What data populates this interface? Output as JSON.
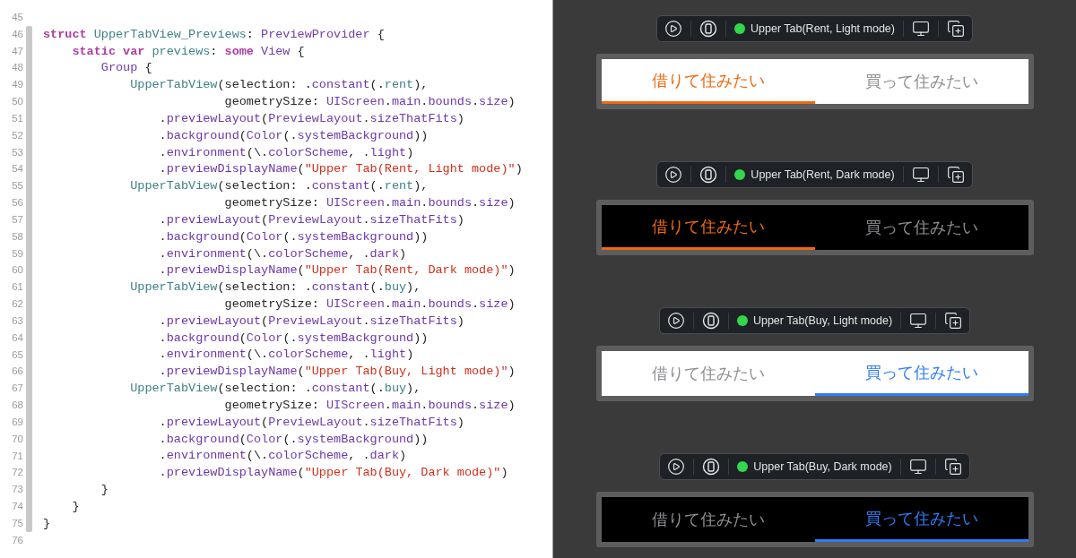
{
  "editor": {
    "lines": [
      {
        "number": "45"
      },
      {
        "number": "46",
        "tokens": [
          {
            "kind": "keyword",
            "text": "struct"
          },
          {
            "kind": "project",
            "text": " UpperTabView_Previews"
          },
          {
            "kind": "plain",
            "text": ": "
          },
          {
            "kind": "type",
            "text": "PreviewProvider"
          },
          {
            "kind": "plain",
            "text": " {"
          }
        ]
      },
      {
        "number": "47",
        "tokens": [
          {
            "kind": "keyword",
            "text": "    static var"
          },
          {
            "kind": "project",
            "text": " previews"
          },
          {
            "kind": "plain",
            "text": ": "
          },
          {
            "kind": "keyword",
            "text": "some"
          },
          {
            "kind": "type",
            "text": " View"
          },
          {
            "kind": "plain",
            "text": " {"
          }
        ]
      },
      {
        "number": "48",
        "tokens": [
          {
            "kind": "type",
            "text": "        Group"
          },
          {
            "kind": "plain",
            "text": " {"
          }
        ]
      },
      {
        "number": "49",
        "tokens": [
          {
            "kind": "project",
            "text": "            UpperTabView"
          },
          {
            "kind": "plain",
            "text": "(selection: ."
          },
          {
            "kind": "member",
            "text": "constant"
          },
          {
            "kind": "plain",
            "text": "(."
          },
          {
            "kind": "project",
            "text": "rent"
          },
          {
            "kind": "plain",
            "text": "),"
          }
        ]
      },
      {
        "number": "50",
        "tokens": [
          {
            "kind": "plain",
            "text": "                         geometrySize: "
          },
          {
            "kind": "type",
            "text": "UIScreen"
          },
          {
            "kind": "plain",
            "text": "."
          },
          {
            "kind": "member",
            "text": "main"
          },
          {
            "kind": "plain",
            "text": "."
          },
          {
            "kind": "member",
            "text": "bounds"
          },
          {
            "kind": "plain",
            "text": "."
          },
          {
            "kind": "member",
            "text": "size"
          },
          {
            "kind": "plain",
            "text": ")"
          }
        ]
      },
      {
        "number": "51",
        "tokens": [
          {
            "kind": "plain",
            "text": "                ."
          },
          {
            "kind": "member",
            "text": "previewLayout"
          },
          {
            "kind": "plain",
            "text": "("
          },
          {
            "kind": "type",
            "text": "PreviewLayout"
          },
          {
            "kind": "plain",
            "text": "."
          },
          {
            "kind": "member",
            "text": "sizeThatFits"
          },
          {
            "kind": "plain",
            "text": ")"
          }
        ]
      },
      {
        "number": "52",
        "tokens": [
          {
            "kind": "plain",
            "text": "                ."
          },
          {
            "kind": "member",
            "text": "background"
          },
          {
            "kind": "plain",
            "text": "("
          },
          {
            "kind": "type",
            "text": "Color"
          },
          {
            "kind": "plain",
            "text": "(."
          },
          {
            "kind": "member",
            "text": "systemBackground"
          },
          {
            "kind": "plain",
            "text": "))"
          }
        ]
      },
      {
        "number": "53",
        "tokens": [
          {
            "kind": "plain",
            "text": "                ."
          },
          {
            "kind": "member",
            "text": "environment"
          },
          {
            "kind": "plain",
            "text": "(\\."
          },
          {
            "kind": "member",
            "text": "colorScheme"
          },
          {
            "kind": "plain",
            "text": ", ."
          },
          {
            "kind": "member",
            "text": "light"
          },
          {
            "kind": "plain",
            "text": ")"
          }
        ]
      },
      {
        "number": "54",
        "tokens": [
          {
            "kind": "plain",
            "text": "                ."
          },
          {
            "kind": "member",
            "text": "previewDisplayName"
          },
          {
            "kind": "plain",
            "text": "("
          },
          {
            "kind": "string",
            "text": "\"Upper Tab(Rent, Light mode)\""
          },
          {
            "kind": "plain",
            "text": ")"
          }
        ]
      },
      {
        "number": "55",
        "tokens": [
          {
            "kind": "project",
            "text": "            UpperTabView"
          },
          {
            "kind": "plain",
            "text": "(selection: ."
          },
          {
            "kind": "member",
            "text": "constant"
          },
          {
            "kind": "plain",
            "text": "(."
          },
          {
            "kind": "project",
            "text": "rent"
          },
          {
            "kind": "plain",
            "text": "),"
          }
        ]
      },
      {
        "number": "56",
        "tokens": [
          {
            "kind": "plain",
            "text": "                         geometrySize: "
          },
          {
            "kind": "type",
            "text": "UIScreen"
          },
          {
            "kind": "plain",
            "text": "."
          },
          {
            "kind": "member",
            "text": "main"
          },
          {
            "kind": "plain",
            "text": "."
          },
          {
            "kind": "member",
            "text": "bounds"
          },
          {
            "kind": "plain",
            "text": "."
          },
          {
            "kind": "member",
            "text": "size"
          },
          {
            "kind": "plain",
            "text": ")"
          }
        ]
      },
      {
        "number": "57",
        "tokens": [
          {
            "kind": "plain",
            "text": "                ."
          },
          {
            "kind": "member",
            "text": "previewLayout"
          },
          {
            "kind": "plain",
            "text": "("
          },
          {
            "kind": "type",
            "text": "PreviewLayout"
          },
          {
            "kind": "plain",
            "text": "."
          },
          {
            "kind": "member",
            "text": "sizeThatFits"
          },
          {
            "kind": "plain",
            "text": ")"
          }
        ]
      },
      {
        "number": "58",
        "tokens": [
          {
            "kind": "plain",
            "text": "                ."
          },
          {
            "kind": "member",
            "text": "background"
          },
          {
            "kind": "plain",
            "text": "("
          },
          {
            "kind": "type",
            "text": "Color"
          },
          {
            "kind": "plain",
            "text": "(."
          },
          {
            "kind": "member",
            "text": "systemBackground"
          },
          {
            "kind": "plain",
            "text": "))"
          }
        ]
      },
      {
        "number": "59",
        "tokens": [
          {
            "kind": "plain",
            "text": "                ."
          },
          {
            "kind": "member",
            "text": "environment"
          },
          {
            "kind": "plain",
            "text": "(\\."
          },
          {
            "kind": "member",
            "text": "colorScheme"
          },
          {
            "kind": "plain",
            "text": ", ."
          },
          {
            "kind": "member",
            "text": "dark"
          },
          {
            "kind": "plain",
            "text": ")"
          }
        ]
      },
      {
        "number": "60",
        "tokens": [
          {
            "kind": "plain",
            "text": "                ."
          },
          {
            "kind": "member",
            "text": "previewDisplayName"
          },
          {
            "kind": "plain",
            "text": "("
          },
          {
            "kind": "string",
            "text": "\"Upper Tab(Rent, Dark mode)\""
          },
          {
            "kind": "plain",
            "text": ")"
          }
        ]
      },
      {
        "number": "61",
        "tokens": [
          {
            "kind": "project",
            "text": "            UpperTabView"
          },
          {
            "kind": "plain",
            "text": "(selection: ."
          },
          {
            "kind": "member",
            "text": "constant"
          },
          {
            "kind": "plain",
            "text": "(."
          },
          {
            "kind": "project",
            "text": "buy"
          },
          {
            "kind": "plain",
            "text": "),"
          }
        ]
      },
      {
        "number": "62",
        "tokens": [
          {
            "kind": "plain",
            "text": "                         geometrySize: "
          },
          {
            "kind": "type",
            "text": "UIScreen"
          },
          {
            "kind": "plain",
            "text": "."
          },
          {
            "kind": "member",
            "text": "main"
          },
          {
            "kind": "plain",
            "text": "."
          },
          {
            "kind": "member",
            "text": "bounds"
          },
          {
            "kind": "plain",
            "text": "."
          },
          {
            "kind": "member",
            "text": "size"
          },
          {
            "kind": "plain",
            "text": ")"
          }
        ]
      },
      {
        "number": "63",
        "tokens": [
          {
            "kind": "plain",
            "text": "                ."
          },
          {
            "kind": "member",
            "text": "previewLayout"
          },
          {
            "kind": "plain",
            "text": "("
          },
          {
            "kind": "type",
            "text": "PreviewLayout"
          },
          {
            "kind": "plain",
            "text": "."
          },
          {
            "kind": "member",
            "text": "sizeThatFits"
          },
          {
            "kind": "plain",
            "text": ")"
          }
        ]
      },
      {
        "number": "64",
        "tokens": [
          {
            "kind": "plain",
            "text": "                ."
          },
          {
            "kind": "member",
            "text": "background"
          },
          {
            "kind": "plain",
            "text": "("
          },
          {
            "kind": "type",
            "text": "Color"
          },
          {
            "kind": "plain",
            "text": "(."
          },
          {
            "kind": "member",
            "text": "systemBackground"
          },
          {
            "kind": "plain",
            "text": "))"
          }
        ]
      },
      {
        "number": "65",
        "tokens": [
          {
            "kind": "plain",
            "text": "                ."
          },
          {
            "kind": "member",
            "text": "environment"
          },
          {
            "kind": "plain",
            "text": "(\\."
          },
          {
            "kind": "member",
            "text": "colorScheme"
          },
          {
            "kind": "plain",
            "text": ", ."
          },
          {
            "kind": "member",
            "text": "light"
          },
          {
            "kind": "plain",
            "text": ")"
          }
        ]
      },
      {
        "number": "66",
        "tokens": [
          {
            "kind": "plain",
            "text": "                ."
          },
          {
            "kind": "member",
            "text": "previewDisplayName"
          },
          {
            "kind": "plain",
            "text": "("
          },
          {
            "kind": "string",
            "text": "\"Upper Tab(Buy, Light mode)\""
          },
          {
            "kind": "plain",
            "text": ")"
          }
        ]
      },
      {
        "number": "67",
        "tokens": [
          {
            "kind": "project",
            "text": "            UpperTabView"
          },
          {
            "kind": "plain",
            "text": "(selection: ."
          },
          {
            "kind": "member",
            "text": "constant"
          },
          {
            "kind": "plain",
            "text": "(."
          },
          {
            "kind": "project",
            "text": "buy"
          },
          {
            "kind": "plain",
            "text": "),"
          }
        ]
      },
      {
        "number": "68",
        "tokens": [
          {
            "kind": "plain",
            "text": "                         geometrySize: "
          },
          {
            "kind": "type",
            "text": "UIScreen"
          },
          {
            "kind": "plain",
            "text": "."
          },
          {
            "kind": "member",
            "text": "main"
          },
          {
            "kind": "plain",
            "text": "."
          },
          {
            "kind": "member",
            "text": "bounds"
          },
          {
            "kind": "plain",
            "text": "."
          },
          {
            "kind": "member",
            "text": "size"
          },
          {
            "kind": "plain",
            "text": ")"
          }
        ]
      },
      {
        "number": "69",
        "tokens": [
          {
            "kind": "plain",
            "text": "                ."
          },
          {
            "kind": "member",
            "text": "previewLayout"
          },
          {
            "kind": "plain",
            "text": "("
          },
          {
            "kind": "type",
            "text": "PreviewLayout"
          },
          {
            "kind": "plain",
            "text": "."
          },
          {
            "kind": "member",
            "text": "sizeThatFits"
          },
          {
            "kind": "plain",
            "text": ")"
          }
        ]
      },
      {
        "number": "70",
        "tokens": [
          {
            "kind": "plain",
            "text": "                ."
          },
          {
            "kind": "member",
            "text": "background"
          },
          {
            "kind": "plain",
            "text": "("
          },
          {
            "kind": "type",
            "text": "Color"
          },
          {
            "kind": "plain",
            "text": "(."
          },
          {
            "kind": "member",
            "text": "systemBackground"
          },
          {
            "kind": "plain",
            "text": "))"
          }
        ]
      },
      {
        "number": "71",
        "tokens": [
          {
            "kind": "plain",
            "text": "                ."
          },
          {
            "kind": "member",
            "text": "environment"
          },
          {
            "kind": "plain",
            "text": "(\\."
          },
          {
            "kind": "member",
            "text": "colorScheme"
          },
          {
            "kind": "plain",
            "text": ", ."
          },
          {
            "kind": "member",
            "text": "dark"
          },
          {
            "kind": "plain",
            "text": ")"
          }
        ]
      },
      {
        "number": "72",
        "tokens": [
          {
            "kind": "plain",
            "text": "                ."
          },
          {
            "kind": "member",
            "text": "previewDisplayName"
          },
          {
            "kind": "plain",
            "text": "("
          },
          {
            "kind": "string",
            "text": "\"Upper Tab(Buy, Dark mode)\""
          },
          {
            "kind": "plain",
            "text": ")"
          }
        ]
      },
      {
        "number": "73",
        "tokens": [
          {
            "kind": "plain",
            "text": "        }"
          }
        ]
      },
      {
        "number": "74",
        "tokens": [
          {
            "kind": "plain",
            "text": "    }"
          }
        ]
      },
      {
        "number": "75",
        "tokens": [
          {
            "kind": "plain",
            "text": "}"
          }
        ]
      },
      {
        "number": "76"
      }
    ]
  },
  "previews": [
    {
      "name": "Upper Tab(Rent, Light mode)",
      "dark": false,
      "color": "#f0690f",
      "tabs": [
        {
          "label": "借りて住みたい",
          "selected": true
        },
        {
          "label": "買って住みたい",
          "selected": false
        }
      ]
    },
    {
      "name": "Upper Tab(Rent, Dark mode)",
      "dark": true,
      "color": "#f0690f",
      "tabs": [
        {
          "label": "借りて住みたい",
          "selected": true
        },
        {
          "label": "買って住みたい",
          "selected": false
        }
      ]
    },
    {
      "name": "Upper Tab(Buy, Light mode)",
      "dark": false,
      "color": "#2f7cf6",
      "tabs": [
        {
          "label": "借りて住みたい",
          "selected": false
        },
        {
          "label": "買って住みたい",
          "selected": true
        }
      ]
    },
    {
      "name": "Upper Tab(Buy, Dark mode)",
      "dark": true,
      "color": "#2f7cf6",
      "tabs": [
        {
          "label": "借りて住みたい",
          "selected": false
        },
        {
          "label": "買って住みたい",
          "selected": true
        }
      ]
    }
  ]
}
